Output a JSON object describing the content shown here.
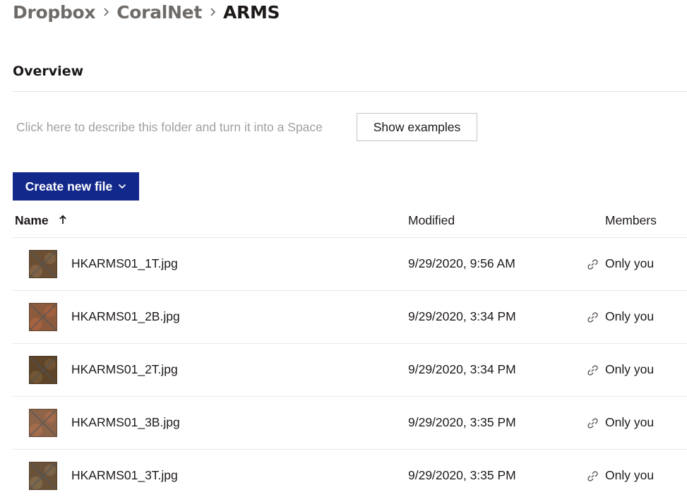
{
  "breadcrumb": {
    "items": [
      "Dropbox",
      "CoralNet"
    ],
    "current": "ARMS"
  },
  "overview": {
    "title": "Overview",
    "describe_prompt": "Click here to describe this folder and turn it into a Space",
    "show_examples_label": "Show examples"
  },
  "toolbar": {
    "create_label": "Create new file"
  },
  "table": {
    "columns": {
      "name": "Name",
      "modified": "Modified",
      "members": "Members"
    },
    "sort": "ascending",
    "rows": [
      {
        "name": "HKARMS01_1T.jpg",
        "modified": "9/29/2020, 9:56 AM",
        "members": "Only you",
        "thumb_base": "#6b4f34",
        "thumb_accent": "#8a6a48"
      },
      {
        "name": "HKARMS01_2B.jpg",
        "modified": "9/29/2020, 3:34 PM",
        "members": "Only you",
        "thumb_base": "#8c5a3c",
        "thumb_accent": "#b06440"
      },
      {
        "name": "HKARMS01_2T.jpg",
        "modified": "9/29/2020, 3:34 PM",
        "members": "Only you",
        "thumb_base": "#5e4428",
        "thumb_accent": "#7a5c38"
      },
      {
        "name": "HKARMS01_3B.jpg",
        "modified": "9/29/2020, 3:35 PM",
        "members": "Only you",
        "thumb_base": "#8e6448",
        "thumb_accent": "#b0704e"
      },
      {
        "name": "HKARMS01_3T.jpg",
        "modified": "9/29/2020, 3:35 PM",
        "members": "Only you",
        "thumb_base": "#6a5238",
        "thumb_accent": "#867050"
      }
    ]
  },
  "colors": {
    "primary_button": "#12288a",
    "breadcrumb_muted": "#6f6b68",
    "placeholder_text": "#a3a09c"
  },
  "icons": {
    "breadcrumb_separator": "chevron-right-icon",
    "create_dropdown": "chevron-down-icon",
    "sort": "arrow-up-icon",
    "members": "link-icon"
  }
}
